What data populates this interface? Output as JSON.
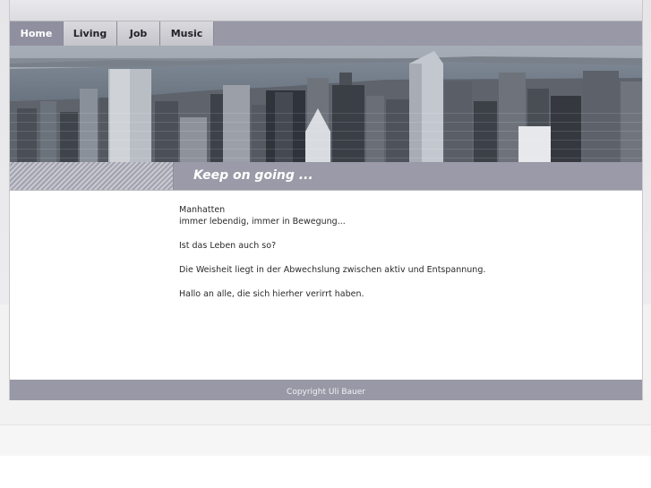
{
  "nav": {
    "items": [
      {
        "label": "Home",
        "active": true
      },
      {
        "label": "Living",
        "active": false
      },
      {
        "label": "Job",
        "active": false
      },
      {
        "label": "Music",
        "active": false
      }
    ]
  },
  "banner": {
    "image": "manhattan-skyline-photo"
  },
  "slogan": "Keep on going ...",
  "content": {
    "line1": "Manhatten",
    "line2": "immer lebendig, immer in Bewegung...",
    "para2": "Ist das Leben auch so?",
    "para3": "Die Weisheit liegt in der Abwechslung zwischen aktiv und Entspannung.",
    "para4": "Hallo an alle, die sich hierher verirrt haben."
  },
  "footer": {
    "copyright": "Copyright Uli Bauer"
  },
  "colors": {
    "nav_bar": "#9898a6",
    "nav_active": "#8f8fa0",
    "slogan_bar": "#9a9aa8",
    "footer": "#9898a6"
  }
}
